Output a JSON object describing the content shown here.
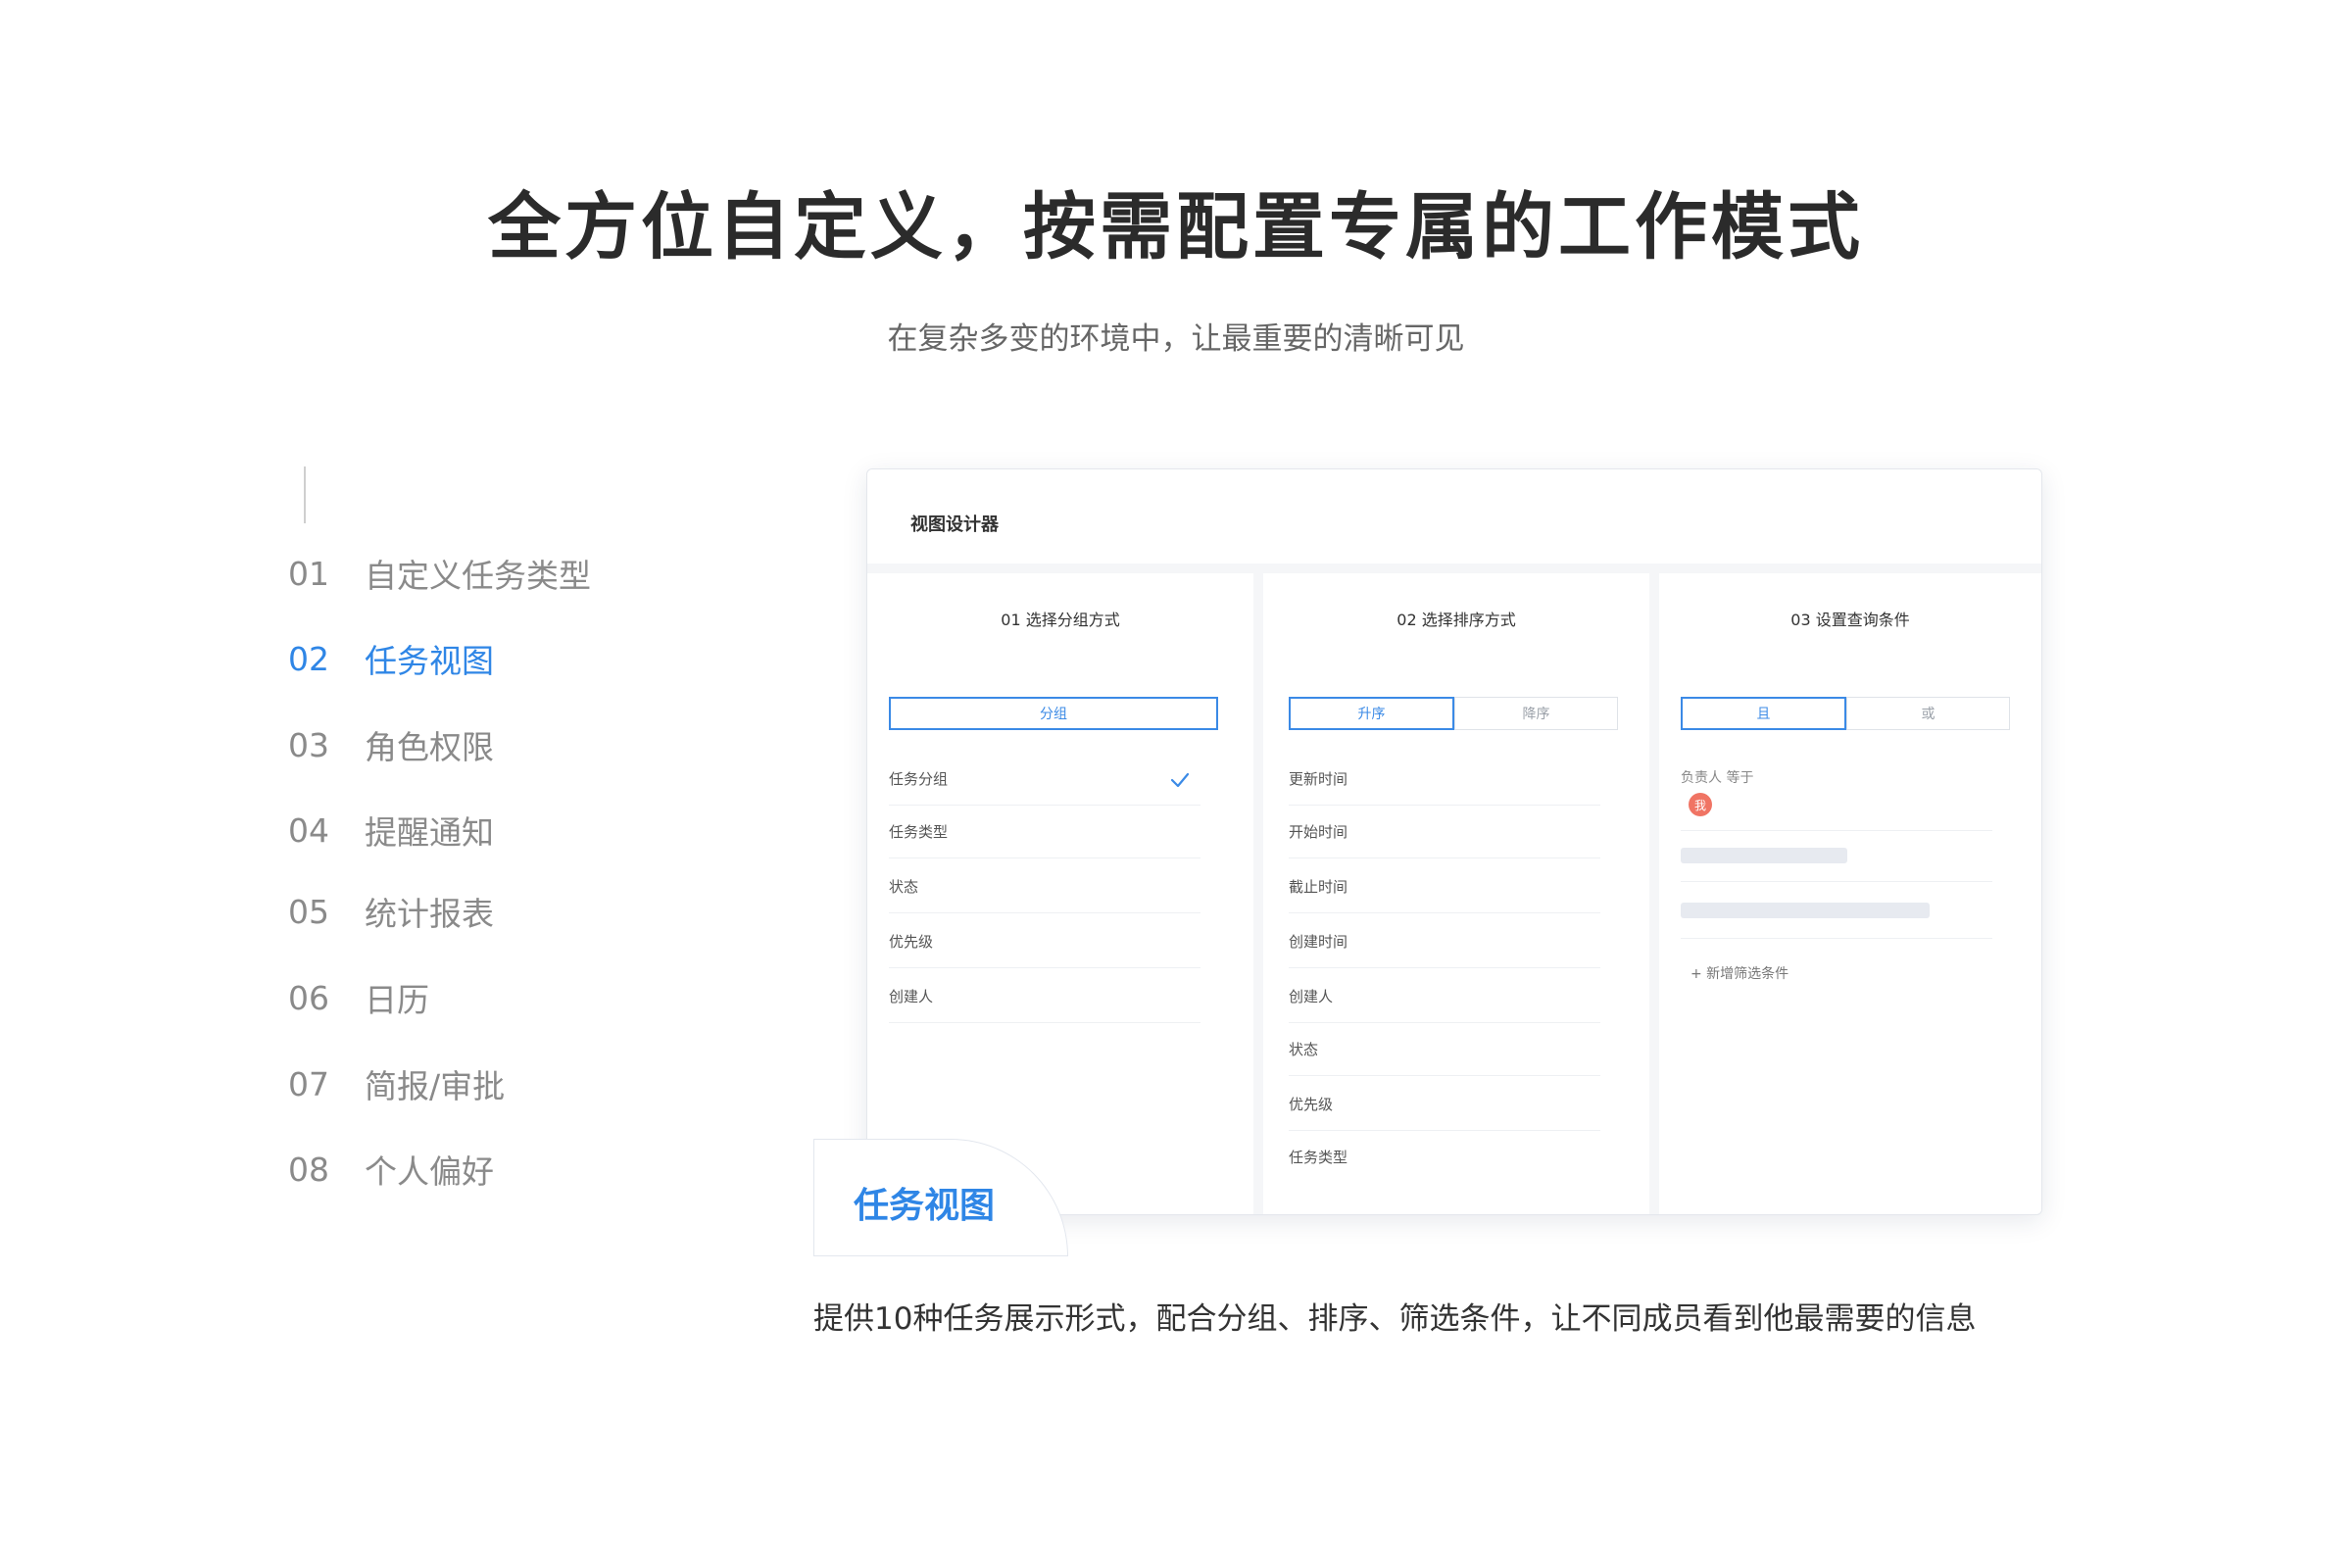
{
  "headline": "全方位自定义，按需配置专属的工作模式",
  "subhead": "在复杂多变的环境中，让最重要的清晰可见",
  "nav": {
    "items": [
      {
        "num": "01",
        "label": "自定义任务类型",
        "active": false
      },
      {
        "num": "02",
        "label": "任务视图",
        "active": true
      },
      {
        "num": "03",
        "label": "角色权限",
        "active": false
      },
      {
        "num": "04",
        "label": "提醒通知",
        "active": false
      },
      {
        "num": "05",
        "label": "统计报表",
        "active": false
      },
      {
        "num": "06",
        "label": "日历",
        "active": false
      },
      {
        "num": "07",
        "label": "简报/审批",
        "active": false
      },
      {
        "num": "08",
        "label": "个人偏好",
        "active": false
      }
    ]
  },
  "designer": {
    "title": "视图设计器",
    "group": {
      "title": "01 选择分组方式",
      "button": "分组",
      "options": [
        "任务分组",
        "任务类型",
        "状态",
        "优先级",
        "创建人"
      ],
      "selected_index": 0
    },
    "sort": {
      "title": "02 选择排序方式",
      "asc": "升序",
      "desc": "降序",
      "options": [
        "更新时间",
        "开始时间",
        "截止时间",
        "创建时间",
        "创建人",
        "状态",
        "优先级",
        "任务类型"
      ]
    },
    "filter": {
      "title": "03 设置查询条件",
      "and": "且",
      "or": "或",
      "condition": "负责人 等于",
      "avatar_text": "我",
      "add": "+ 新增筛选条件"
    }
  },
  "tag": "任务视图",
  "description": "提供10种任务展示形式，配合分组、排序、筛选条件，让不同成员看到他最需要的信息",
  "colors": {
    "accent": "#2f86e6",
    "avatar": "#f07464"
  }
}
